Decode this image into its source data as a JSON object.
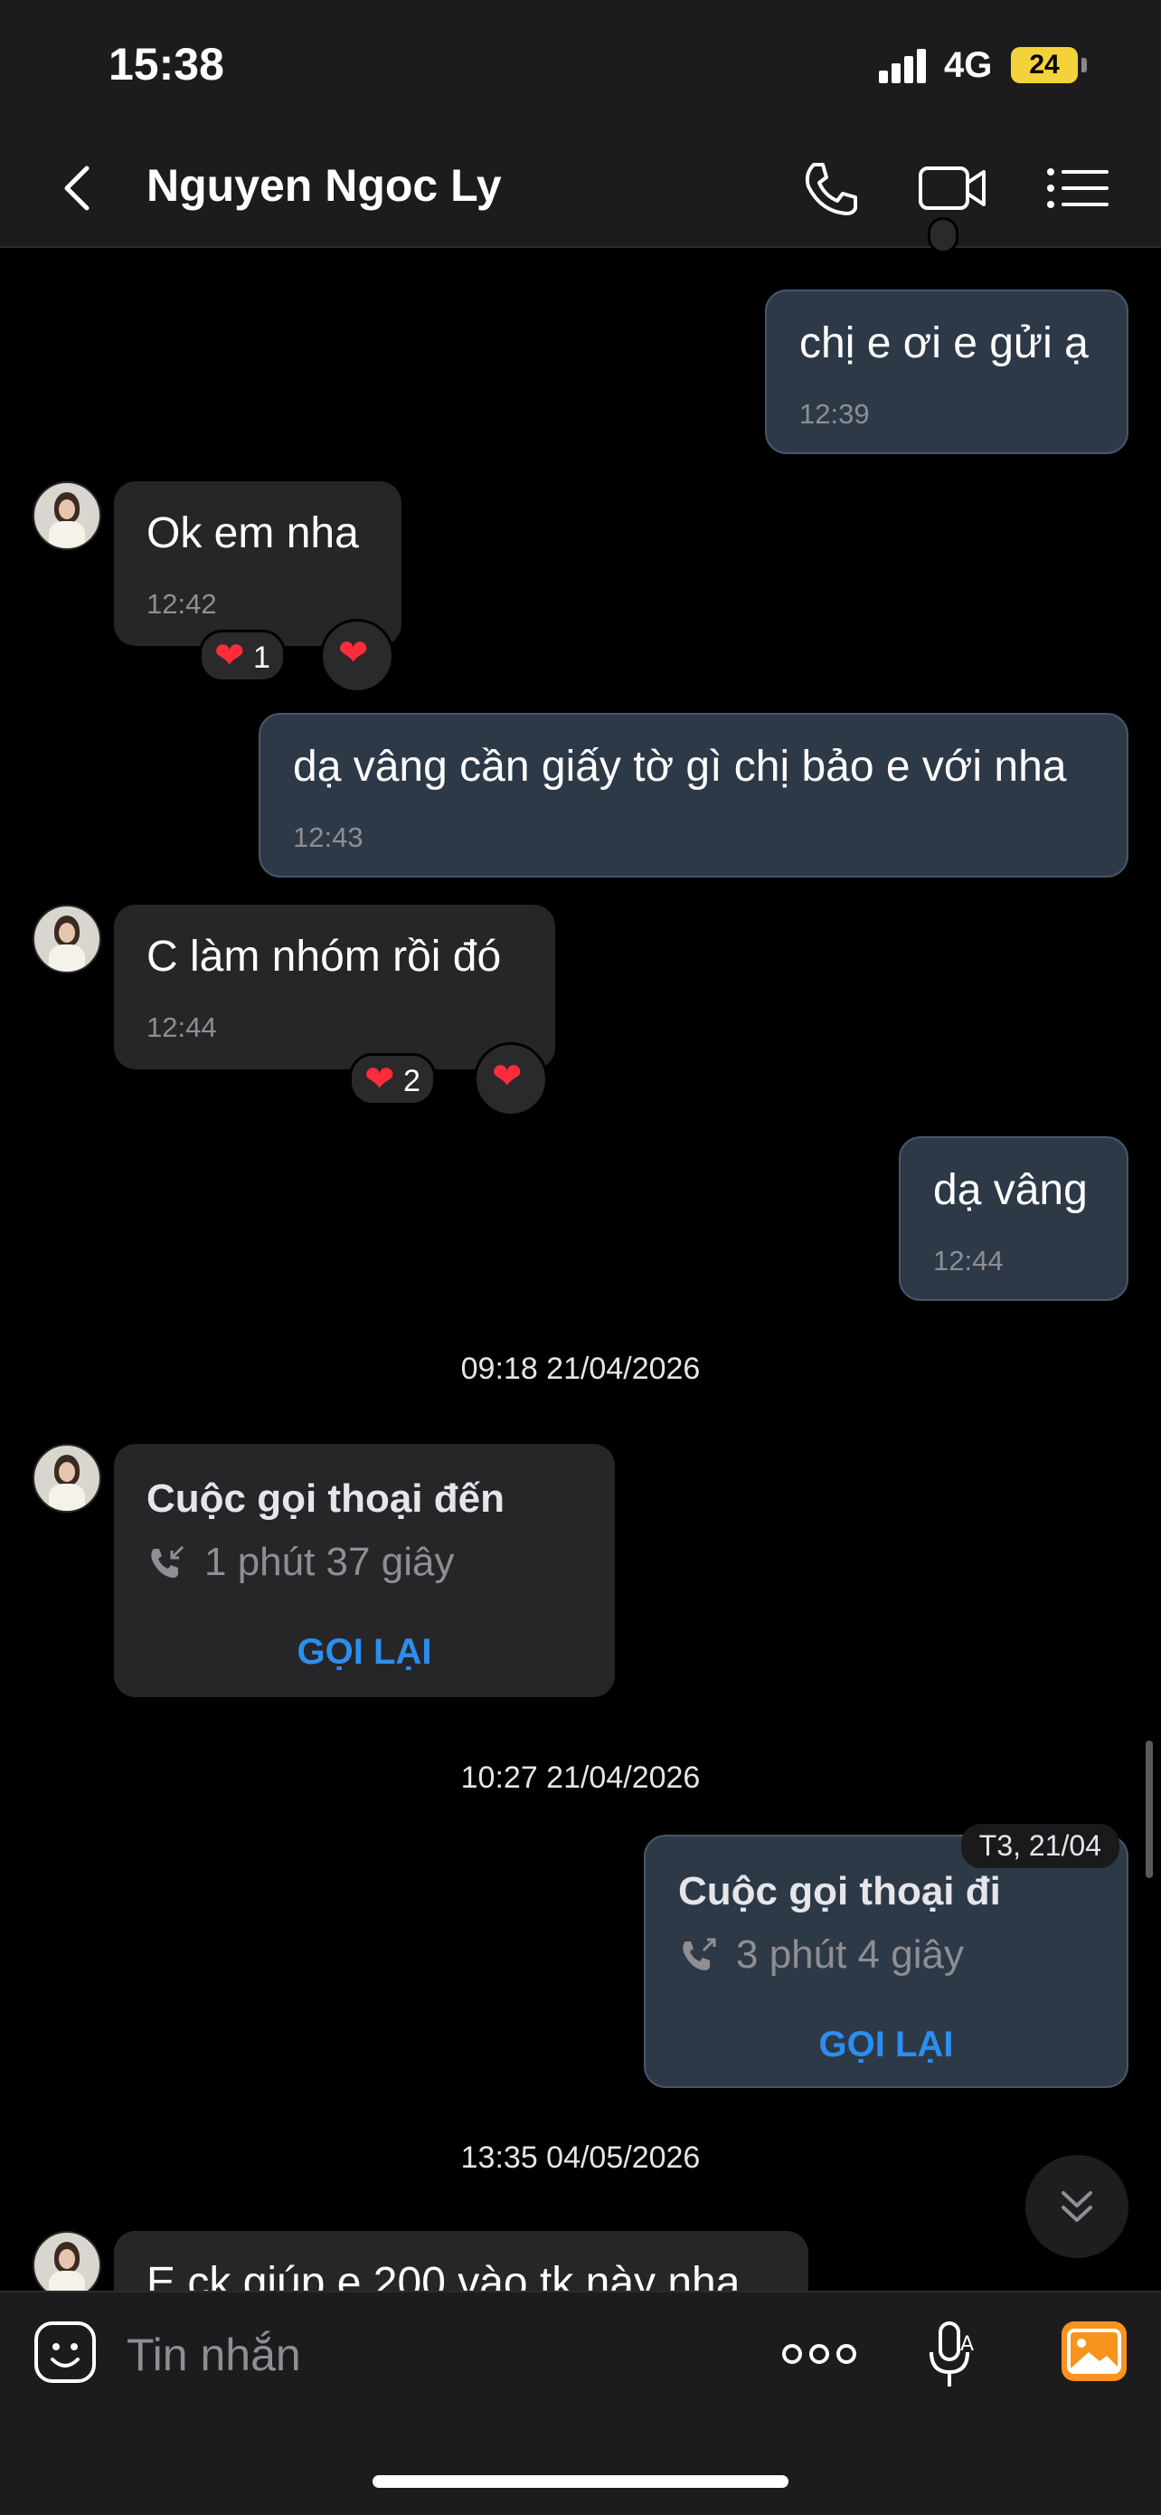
{
  "status_bar": {
    "time": "15:38",
    "network": "4G",
    "battery": "24"
  },
  "header": {
    "title": "Nguyen Ngoc Ly"
  },
  "messages": [
    {
      "text": "chị e ơi e gửi ạ",
      "time": "12:39",
      "direction": "out"
    },
    {
      "text": "Ok em nha",
      "time": "12:42",
      "direction": "in",
      "reaction_count": "1"
    },
    {
      "text": "dạ vâng cần giấy tờ gì chị bảo e với nha",
      "time": "12:43",
      "direction": "out"
    },
    {
      "text": "C làm nhóm rồi đó",
      "time": "12:44",
      "direction": "in",
      "reaction_count": "2"
    },
    {
      "text": "dạ vâng",
      "time": "12:44",
      "direction": "out"
    }
  ],
  "timestamps": [
    "09:18 21/04/2026",
    "10:27 21/04/2026",
    "13:35 04/05/2026"
  ],
  "calls": [
    {
      "title": "Cuộc gọi thoại đến",
      "duration": "1 phút 37 giây",
      "action": "GỌI LẠI",
      "direction": "in"
    },
    {
      "title": "Cuộc gọi thoại đi",
      "duration": "3 phút 4 giây",
      "action": "GỌI LẠI",
      "direction": "out",
      "day_tag": "T3, 21/04"
    }
  ],
  "partial_message": {
    "text": "E ck giúp e 200 vào tk này nha"
  },
  "input": {
    "placeholder": "Tin nhắn"
  },
  "colors": {
    "accent": "#2b8ef0",
    "out_bubble": "#2e3947",
    "in_bubble": "#262628",
    "heart": "#ff2d3a",
    "image_button": "#f7931e"
  }
}
